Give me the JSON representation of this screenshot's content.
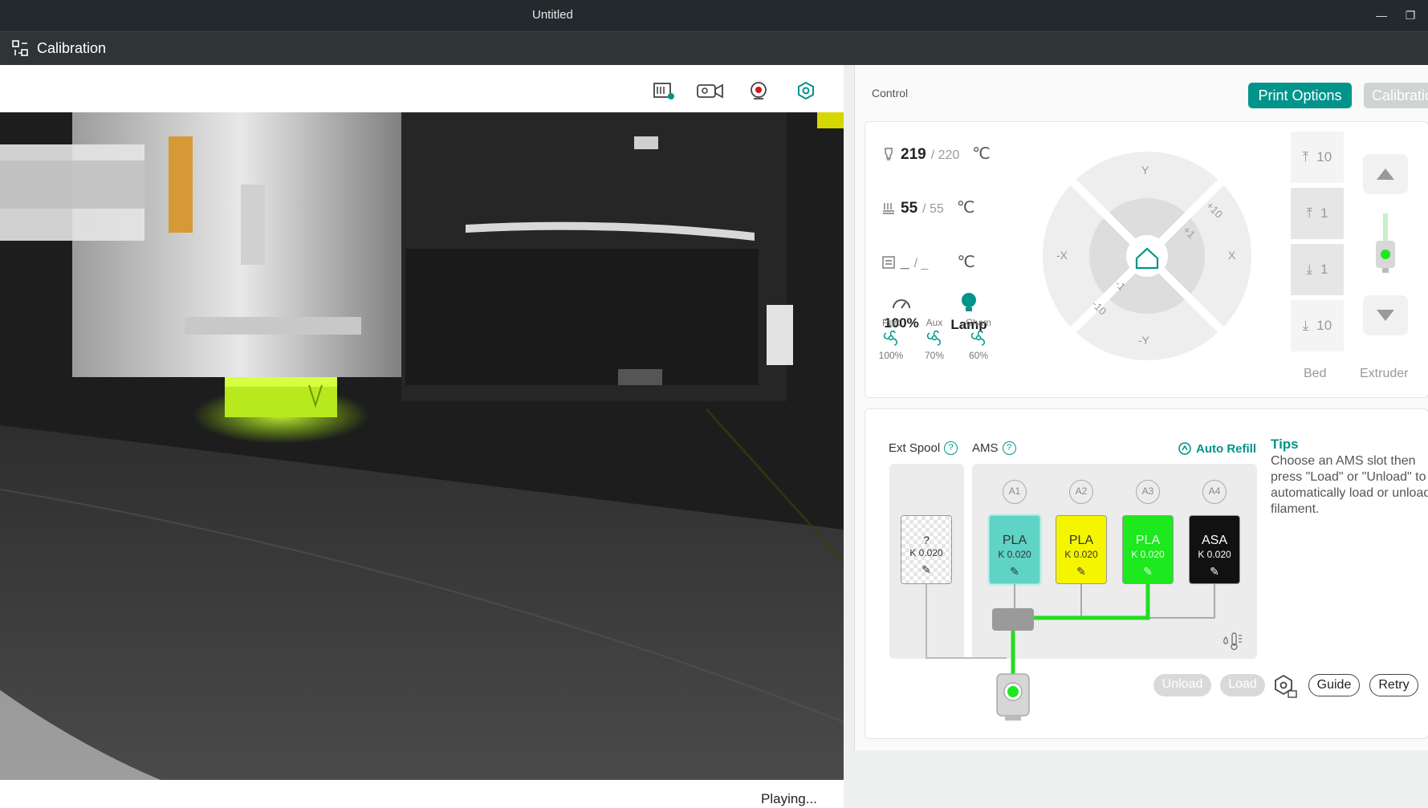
{
  "window": {
    "title": "Untitled",
    "minimize_glyph": "—",
    "maximize_glyph": "❐"
  },
  "tabbar": {
    "tab_label": "Calibration",
    "tab_icon": "calibration-icon"
  },
  "video": {
    "toolbar_icons": [
      "sd-card-icon",
      "recording-icon",
      "webcam-icon",
      "settings-icon"
    ],
    "status": "Playing..."
  },
  "control": {
    "label": "Control",
    "print_options_label": "Print Options",
    "calibration_label": "Calibration",
    "nozzle": {
      "current": "219",
      "target": "/ 220",
      "unit": "℃"
    },
    "bed": {
      "current": "55",
      "target": "/ 55",
      "unit": "℃"
    },
    "chamber": {
      "current": "_",
      "target": "/ _",
      "unit": "℃"
    },
    "speed": {
      "value": "100%"
    },
    "lamp": {
      "label": "Lamp"
    },
    "fans": [
      {
        "label": "Part",
        "pct": "100%"
      },
      {
        "label": "Aux",
        "pct": "70%"
      },
      {
        "label": "Cham",
        "pct": "60%"
      }
    ],
    "jog": {
      "y_pos": "Y",
      "y_neg": "-Y",
      "x_pos": "X",
      "x_neg": "-X",
      "p10": "+10",
      "p1": "+1",
      "m1": "-1",
      "m10": "-10"
    },
    "z": {
      "up10": "10",
      "up1": "1",
      "down1": "1",
      "down10": "10"
    },
    "bed_label": "Bed",
    "extruder_label": "Extruder"
  },
  "ams": {
    "ext_spool_label": "Ext Spool",
    "ams_label": "AMS",
    "auto_refill_label": "Auto Refill",
    "ext_spool": {
      "name": "?",
      "k": "K 0.020"
    },
    "slots": [
      {
        "tag": "A1",
        "name": "PLA",
        "k": "K 0.020",
        "color": "#5fd3c5",
        "text": "#333"
      },
      {
        "tag": "A2",
        "name": "PLA",
        "k": "K 0.020",
        "color": "#f5f500",
        "text": "#333"
      },
      {
        "tag": "A3",
        "name": "PLA",
        "k": "K 0.020",
        "color": "#1ee81e",
        "text": "#eaffea"
      },
      {
        "tag": "A4",
        "name": "ASA",
        "k": "K 0.020",
        "color": "#111111",
        "text": "#ffffff"
      }
    ],
    "tips_title": "Tips",
    "tips_text": "Choose an AMS slot then press \"Load\" or \"Unload\" to automatically load or unload filament.",
    "unload_label": "Unload",
    "load_label": "Load",
    "guide_label": "Guide",
    "retry_label": "Retry"
  },
  "colors": {
    "accent": "#00948b",
    "filament_path": "#22dd22"
  }
}
